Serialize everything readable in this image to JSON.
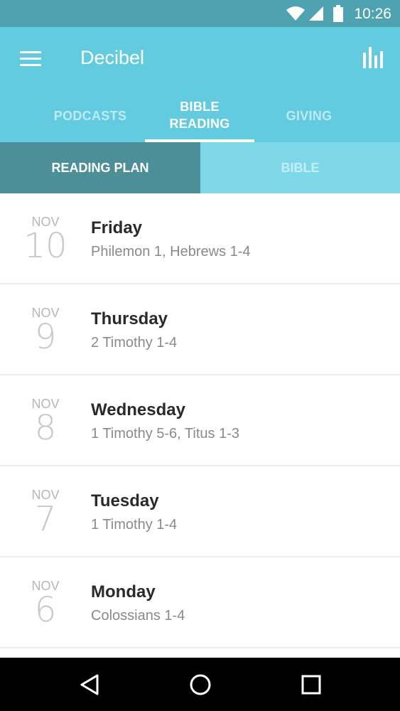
{
  "status_bar": {
    "time": "10:26",
    "icons": [
      "wifi-icon",
      "signal-icon",
      "battery-icon"
    ]
  },
  "app_bar": {
    "title": "Decibel",
    "menu_icon": "hamburger-menu-icon",
    "action_icon": "bar-chart-icon"
  },
  "tabs": [
    {
      "label": "PODCASTS",
      "active": false
    },
    {
      "label": "BIBLE READING",
      "active": true
    },
    {
      "label": "GIVING",
      "active": false
    }
  ],
  "sub_tabs": [
    {
      "label": "READING PLAN",
      "active": true
    },
    {
      "label": "BIBLE",
      "active": false
    }
  ],
  "readings": [
    {
      "month": "NOV",
      "day": "10",
      "weekday": "Friday",
      "passage": "Philemon 1, Hebrews 1-4"
    },
    {
      "month": "NOV",
      "day": "9",
      "weekday": "Thursday",
      "passage": "2 Timothy 1-4"
    },
    {
      "month": "NOV",
      "day": "8",
      "weekday": "Wednesday",
      "passage": "1 Timothy 5-6, Titus 1-3"
    },
    {
      "month": "NOV",
      "day": "7",
      "weekday": "Tuesday",
      "passage": "1 Timothy 1-4"
    },
    {
      "month": "NOV",
      "day": "6",
      "weekday": "Monday",
      "passage": "Colossians 1-4"
    }
  ],
  "nav_bar": {
    "icons": [
      "back-icon",
      "home-icon",
      "recents-icon"
    ]
  },
  "colors": {
    "status_bar": "#4fa3b0",
    "app_bar": "#62cbe0",
    "sub_tab_active": "#4d8f99",
    "sub_tab_inactive": "#7fd8e8",
    "nav_bar": "#000000"
  }
}
